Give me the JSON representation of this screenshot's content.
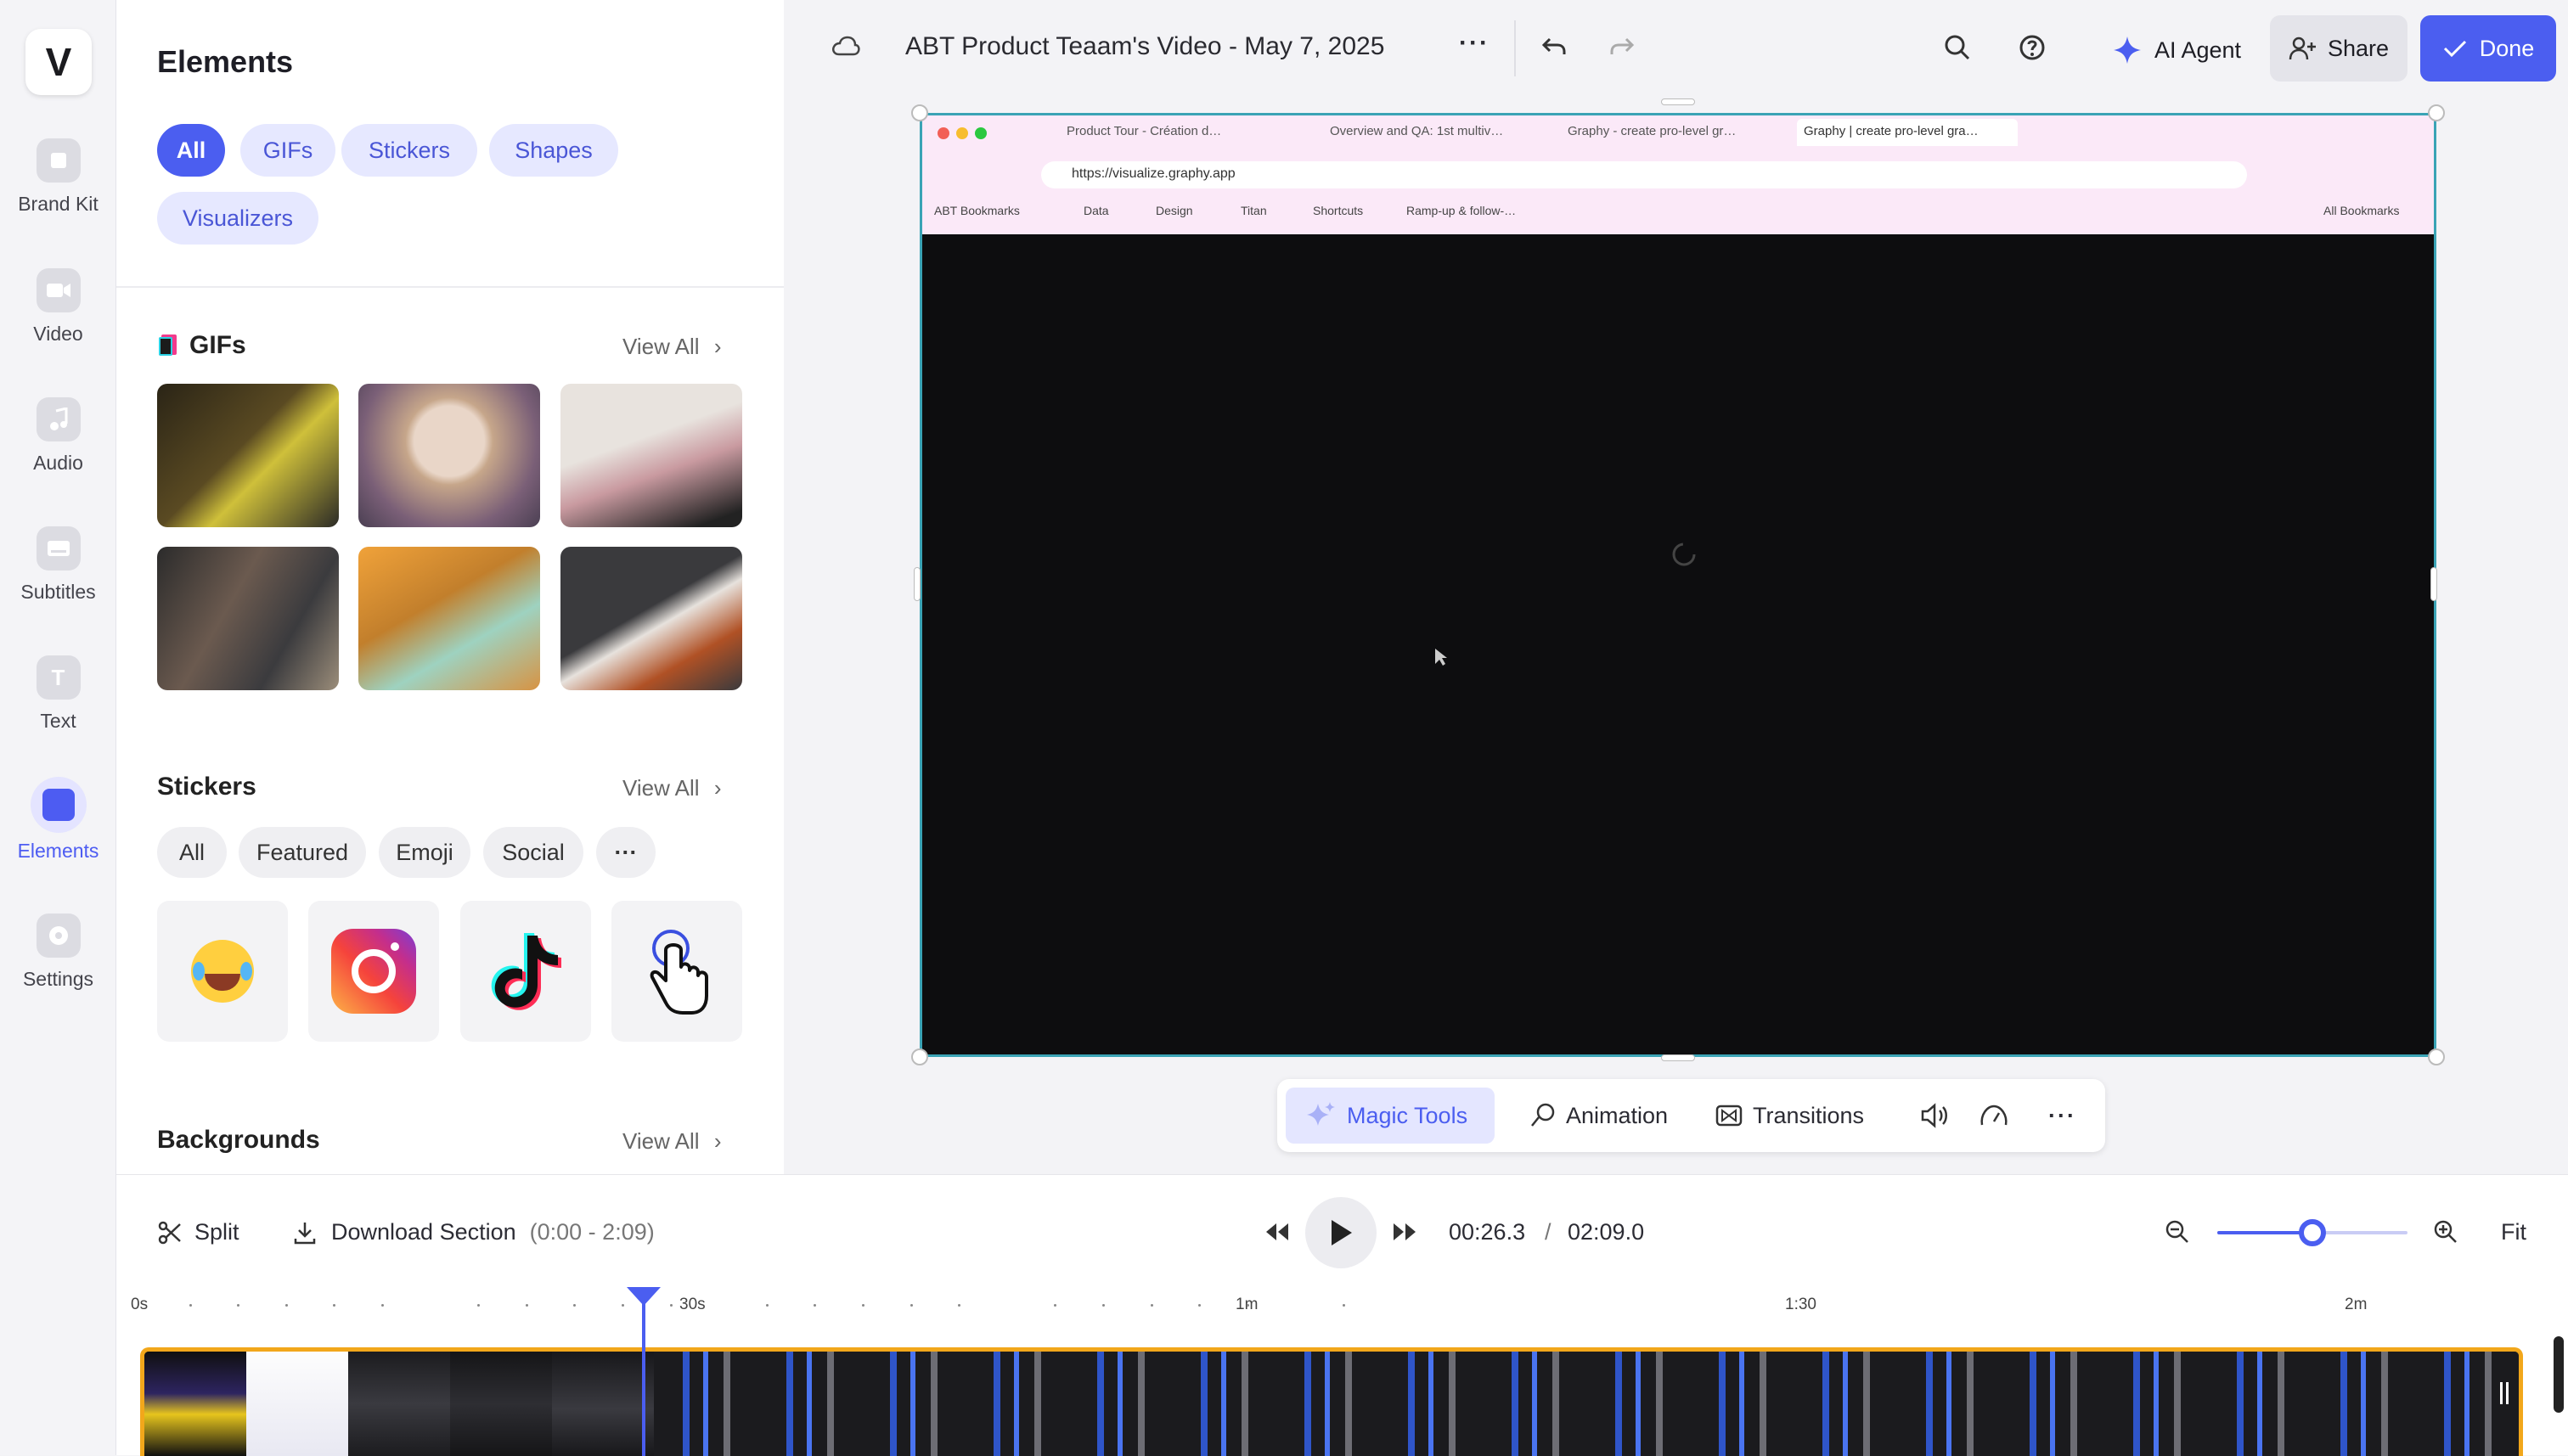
{
  "brand": {
    "logo_letter": "V"
  },
  "rail": {
    "items": [
      {
        "label": "Brand Kit",
        "icon": "brand-kit-icon"
      },
      {
        "label": "Video",
        "icon": "video-icon"
      },
      {
        "label": "Audio",
        "icon": "music-note-icon"
      },
      {
        "label": "Subtitles",
        "icon": "subtitles-icon"
      },
      {
        "label": "Text",
        "icon": "text-icon"
      },
      {
        "label": "Elements",
        "icon": "elements-icon",
        "active": true
      },
      {
        "label": "Settings",
        "icon": "settings-icon"
      }
    ]
  },
  "panel": {
    "title": "Elements",
    "filters": [
      "All",
      "GIFs",
      "Stickers",
      "Shapes",
      "Visualizers"
    ],
    "selected_filter": "All",
    "gifs": {
      "title": "GIFs",
      "view_all": "View All"
    },
    "stickers": {
      "title": "Stickers",
      "view_all": "View All",
      "filters": [
        "All",
        "Featured",
        "Emoji",
        "Social",
        "···"
      ]
    },
    "backgrounds": {
      "title": "Backgrounds",
      "view_all": "View All"
    }
  },
  "topbar": {
    "project_title": "ABT Product Teaam's Video - May 7, 2025",
    "more": "···",
    "ai_agent": "AI Agent",
    "share": "Share",
    "done": "Done"
  },
  "browser": {
    "tabs": [
      "Product Tour - Création d…",
      "Overview and QA: 1st multiv…",
      "Graphy - create pro-level gr…",
      "Graphy | create pro-level gra…"
    ],
    "url": "https://visualize.graphy.app",
    "bookmarks": [
      "ABT Bookmarks",
      "Data",
      "Design",
      "Titan",
      "Shortcuts",
      "Ramp-up & follow-…"
    ],
    "all_bookmarks": "All Bookmarks"
  },
  "tools": {
    "magic": "Magic Tools",
    "animation": "Animation",
    "transitions": "Transitions",
    "more": "···"
  },
  "timeline": {
    "split": "Split",
    "download": "Download Section",
    "range": "(0:00 - 2:09)",
    "current": "00:26.3",
    "separator": "/",
    "total": "02:09.0",
    "fit": "Fit",
    "zoom_level": 0.5,
    "ticks": [
      "0s",
      "30s",
      "1m",
      "1:30",
      "2m"
    ]
  },
  "colors": {
    "accent": "#4b5ef0",
    "track_border": "#f2a71b",
    "stage_border": "#3aa3b5"
  }
}
